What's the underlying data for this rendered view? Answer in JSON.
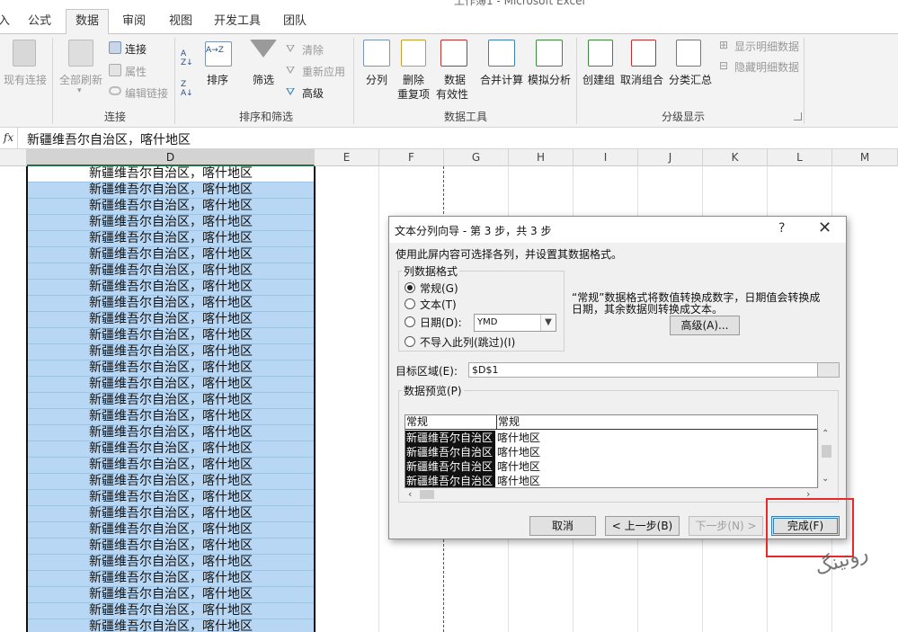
{
  "window_title": "工作簿1 - Microsoft Excel",
  "tabs": [
    {
      "label": "插入"
    },
    {
      "label": "公式"
    },
    {
      "label": "数据"
    },
    {
      "label": "审阅"
    },
    {
      "label": "视图"
    },
    {
      "label": "开发工具"
    },
    {
      "label": "团队"
    }
  ],
  "ribbon": {
    "existing_connections": "现有连接",
    "refresh_all": "全部刷新",
    "connections": "连接",
    "properties": "属性",
    "edit_links": "编辑链接",
    "group_connections": "连接",
    "sort_asc": "A→Z",
    "sort_desc": "Z→A",
    "sort": "排序",
    "filter": "筛选",
    "clear": "清除",
    "reapply": "重新应用",
    "advanced": "高级",
    "group_sort_filter": "排序和筛选",
    "text_to_columns": "分列",
    "remove_duplicates_1": "删除",
    "remove_duplicates_2": "重复项",
    "data_validation_1": "数据",
    "data_validation_2": "有效性",
    "consolidate": "合并计算",
    "what_if": "模拟分析",
    "group_data_tools": "数据工具",
    "group": "创建组",
    "ungroup": "取消组合",
    "subtotal": "分类汇总",
    "show_detail": "显示明细数据",
    "hide_detail": "隐藏明细数据",
    "group_outline": "分级显示"
  },
  "formula_bar": {
    "fx": "fx",
    "value": "新疆维吾尔自治区，喀什地区"
  },
  "columns": [
    "D",
    "E",
    "F",
    "G",
    "H",
    "I",
    "J",
    "K",
    "L",
    "M"
  ],
  "cells": [
    "新疆维吾尔自治区，喀什地区",
    "新疆维吾尔自治区，喀什地区",
    "新疆维吾尔自治区，喀什地区",
    "新疆维吾尔自治区，喀什地区",
    "新疆维吾尔自治区，喀什地区",
    "新疆维吾尔自治区，喀什地区",
    "新疆维吾尔自治区，喀什地区",
    "新疆维吾尔自治区，喀什地区",
    "新疆维吾尔自治区，喀什地区",
    "新疆维吾尔自治区，喀什地区",
    "新疆维吾尔自治区，喀什地区",
    "新疆维吾尔自治区，喀什地区",
    "新疆维吾尔自治区，喀什地区",
    "新疆维吾尔自治区，喀什地区",
    "新疆维吾尔自治区，喀什地区",
    "新疆维吾尔自治区，喀什地区",
    "新疆维吾尔自治区，喀什地区",
    "新疆维吾尔自治区，喀什地区",
    "新疆维吾尔自治区，喀什地区",
    "新疆维吾尔自治区，喀什地区",
    "新疆维吾尔自治区，喀什地区",
    "新疆维吾尔自治区，喀什地区",
    "新疆维吾尔自治区，喀什地区",
    "新疆维吾尔自治区，喀什地区",
    "新疆维吾尔自治区，喀什地区",
    "新疆维吾尔自治区，喀什地区",
    "新疆维吾尔自治区，喀什地区",
    "新疆维吾尔自治区，喀什地区",
    "新疆维吾尔自治区，喀什地区"
  ],
  "dialog": {
    "title": "文本分列向导 - 第 3 步，共 3 步",
    "help": "?",
    "close": "✕",
    "intro": "使用此屏内容可选择各列，并设置其数据格式。",
    "format_legend": "列数据格式",
    "opt_general": "常规(G)",
    "opt_text": "文本(T)",
    "opt_date": "日期(D):",
    "date_format": "YMD",
    "opt_skip": "不导入此列(跳过)(I)",
    "note_line1": "“常规”数据格式将数值转换成数字，日期值会转换成",
    "note_line2": "日期，其余数据则转换成文本。",
    "advanced_btn": "高级(A)...",
    "dest_label": "目标区域(E):",
    "dest_value": "$D$1",
    "preview_legend": "数据预览(P)",
    "preview_headers": [
      "常规",
      "常规"
    ],
    "preview_rows": [
      [
        "新疆维吾尔自治区",
        "喀什地区"
      ],
      [
        "新疆维吾尔自治区",
        "喀什地区"
      ],
      [
        "新疆维吾尔自治区",
        "喀什地区"
      ],
      [
        "新疆维吾尔自治区",
        "喀什地区"
      ]
    ],
    "cancel": "取消",
    "back": "< 上一步(B)",
    "next": "下一步(N) >",
    "finish": "完成(F)"
  },
  "watermark": "روتینگ"
}
